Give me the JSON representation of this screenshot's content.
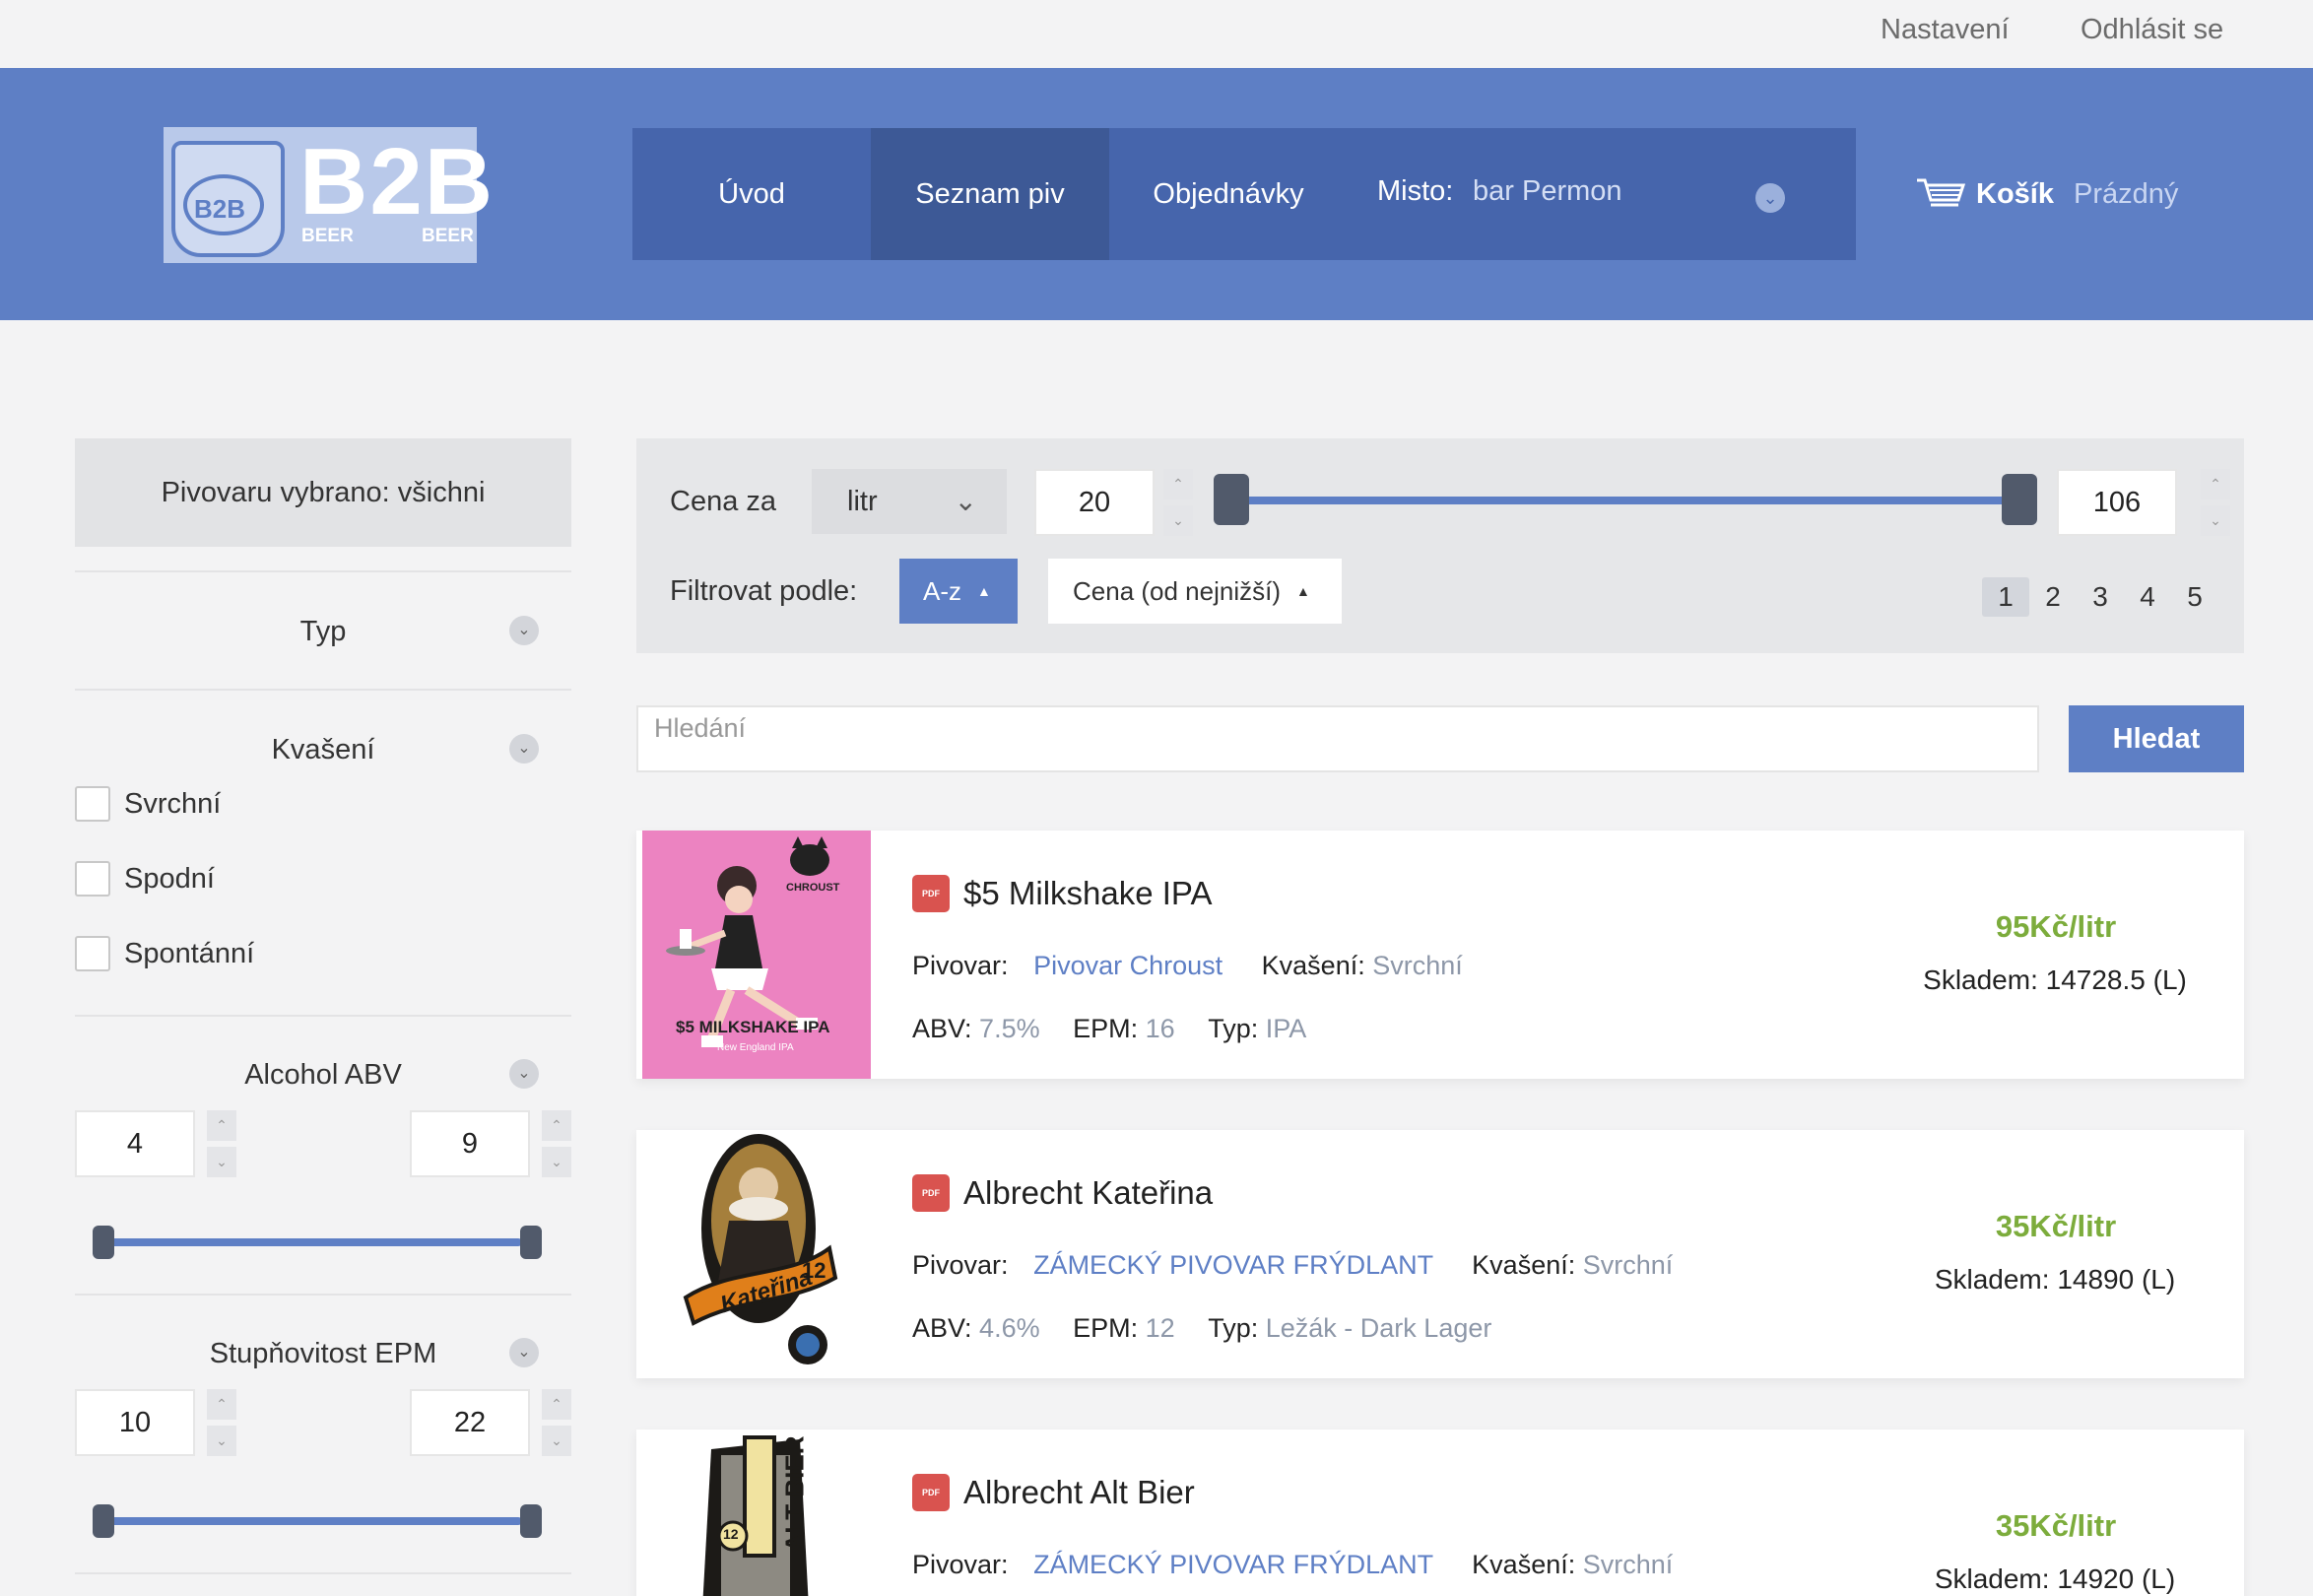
{
  "topbar": {
    "settings": "Nastavení",
    "logout": "Odhlásit se"
  },
  "logo": {
    "mug_text": "B2B",
    "brand": "B2B",
    "beer_left": "BEER",
    "beer_right": "BEER"
  },
  "nav": {
    "items": [
      "Úvod",
      "Seznam piv",
      "Objednávky"
    ],
    "active": "Seznam piv",
    "place_label": "Misto:",
    "place_value": "bar Permon"
  },
  "cart": {
    "label": "Košík",
    "status": "Prázdný"
  },
  "sidebar": {
    "breweries": "Pivovaru vybrano: všichni",
    "type_title": "Typ",
    "fermentation_title": "Kvašení",
    "fermentation_options": [
      "Svrchní",
      "Spodní",
      "Spontánní"
    ],
    "abv_title": "Alcohol ABV",
    "abv_min": "4",
    "abv_max": "9",
    "epm_title": "Stupňovitost EPM",
    "epm_min": "10",
    "epm_max": "22"
  },
  "filters": {
    "price_label": "Cena za",
    "unit": "litr",
    "price_min": "20",
    "price_max": "106",
    "sort_label": "Filtrovat podle:",
    "sort_az": "A-z",
    "sort_price": "Cena (od nejnižší)",
    "pages": [
      "1",
      "2",
      "3",
      "4",
      "5"
    ],
    "current_page": "1"
  },
  "search": {
    "placeholder": "Hledání",
    "button": "Hledat"
  },
  "labels": {
    "brewery": "Pivovar:",
    "fermentation": "Kvašení:",
    "abv": "ABV:",
    "epm": "EPM:",
    "type": "Typ:",
    "stock": "Skladem:",
    "pdf": "PDF"
  },
  "products": [
    {
      "name": "$5 Milkshake IPA",
      "brewery": "Pivovar Chroust",
      "fermentation": "Svrchní",
      "abv": "7.5%",
      "epm": "16",
      "type": "IPA",
      "price": "95Kč/litr",
      "stock": "14728.5 (L)",
      "label_text": "$5 MILKSHAKE IPA",
      "label_sub": "New England IPA",
      "label_brand": "CHROUST"
    },
    {
      "name": "Albrecht Kateřina",
      "brewery": "ZÁMECKÝ PIVOVAR FRÝDLANT",
      "fermentation": "Svrchní",
      "abv": "4.6%",
      "epm": "12",
      "type": "Ležák - Dark Lager",
      "price": "35Kč/litr",
      "stock": "14890 (L)",
      "label_text": "Kateřina",
      "label_sub": "12"
    },
    {
      "name": "Albrecht Alt Bier",
      "brewery": "ZÁMECKÝ PIVOVAR FRÝDLANT",
      "fermentation": "Svrchní",
      "abv": "",
      "epm": "",
      "type": "",
      "price": "35Kč/litr",
      "stock": "14920 (L)",
      "label_text": "ALT BIER",
      "label_sub": "12"
    }
  ],
  "colors": {
    "accent": "#5e7fc5",
    "nav": "#4665ac",
    "price": "#7cac3c",
    "pdf": "#d9534f"
  }
}
